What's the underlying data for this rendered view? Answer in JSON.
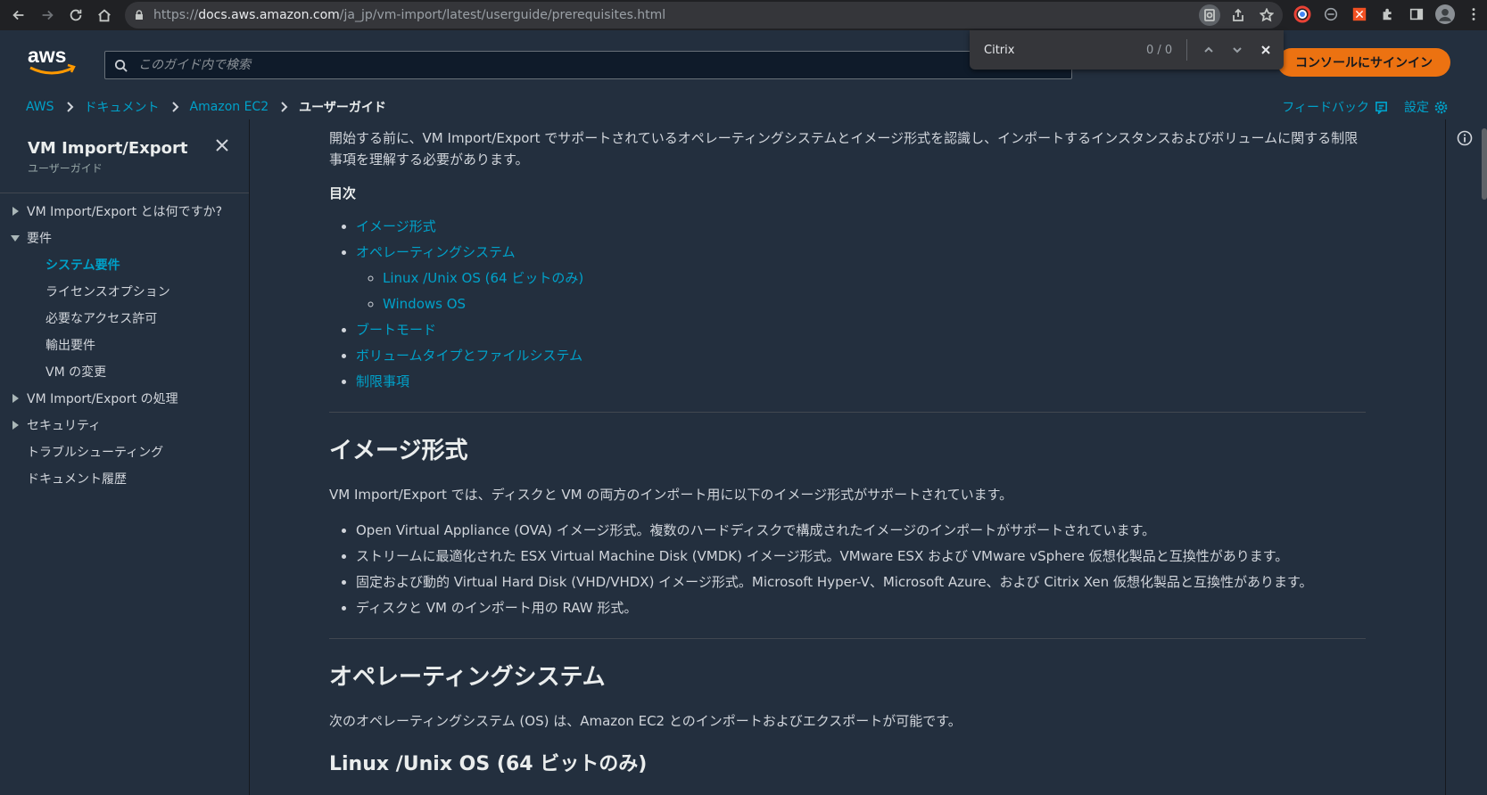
{
  "browser": {
    "url_prefix": "https://",
    "url_host": "docs.aws.amazon.com",
    "url_path": "/ja_jp/vm-import/latest/userguide/prerequisites.html"
  },
  "findbar": {
    "query": "Citrix",
    "count": "0 / 0"
  },
  "header": {
    "search_placeholder": "このガイド内で検索",
    "signin_label": "コンソールにサインイン",
    "brand_color": "#ec7211"
  },
  "breadcrumb": {
    "items": [
      "AWS",
      "ドキュメント",
      "Amazon EC2"
    ],
    "current": "ユーザーガイド",
    "feedback": "フィードバック",
    "settings": "設定"
  },
  "sidebar": {
    "title": "VM Import/Export",
    "subtitle": "ユーザーガイド",
    "items": [
      {
        "label": "VM Import/Export とは何ですか?",
        "level": 0,
        "toggle": "collapsed"
      },
      {
        "label": "要件",
        "level": 0,
        "toggle": "expanded"
      },
      {
        "label": "システム要件",
        "level": 1,
        "active": true
      },
      {
        "label": "ライセンスオプション",
        "level": 1
      },
      {
        "label": "必要なアクセス許可",
        "level": 1
      },
      {
        "label": "輸出要件",
        "level": 1
      },
      {
        "label": "VM の変更",
        "level": 1
      },
      {
        "label": "VM Import/Export の処理",
        "level": 0,
        "toggle": "collapsed"
      },
      {
        "label": "セキュリティ",
        "level": 0,
        "toggle": "collapsed"
      },
      {
        "label": "トラブルシューティング",
        "level": 0
      },
      {
        "label": "ドキュメント履歴",
        "level": 0
      }
    ]
  },
  "main": {
    "intro": "開始する前に、VM Import/Export でサポートされているオペレーティングシステムとイメージ形式を認識し、インポートするインスタンスおよびボリュームに関する制限事項を理解する必要があります。",
    "toc_heading": "目次",
    "toc": {
      "image_formats": "イメージ形式",
      "os": "オペレーティングシステム",
      "linux": "Linux /Unix OS (64 ビットのみ)",
      "windows": "Windows OS",
      "boot": "ブートモード",
      "volume": "ボリュームタイプとファイルシステム",
      "limits": "制限事項"
    },
    "section1": {
      "heading": "イメージ形式",
      "body": "VM Import/Export では、ディスクと VM の両方のインポート用に以下のイメージ形式がサポートされています。",
      "bullets": [
        "Open Virtual Appliance (OVA) イメージ形式。複数のハードディスクで構成されたイメージのインポートがサポートされています。",
        "ストリームに最適化された ESX Virtual Machine Disk (VMDK) イメージ形式。VMware ESX および VMware vSphere 仮想化製品と互換性があります。",
        "固定および動的 Virtual Hard Disk (VHD/VHDX) イメージ形式。Microsoft Hyper-V、Microsoft Azure、および Citrix Xen 仮想化製品と互換性があります。",
        "ディスクと VM のインポート用の RAW 形式。"
      ]
    },
    "section2": {
      "heading": "オペレーティングシステム",
      "body": "次のオペレーティングシステム (OS) は、Amazon EC2 とのインポートおよびエクスポートが可能です。"
    },
    "section3": {
      "heading": "Linux /Unix OS (64 ビットのみ)"
    }
  }
}
